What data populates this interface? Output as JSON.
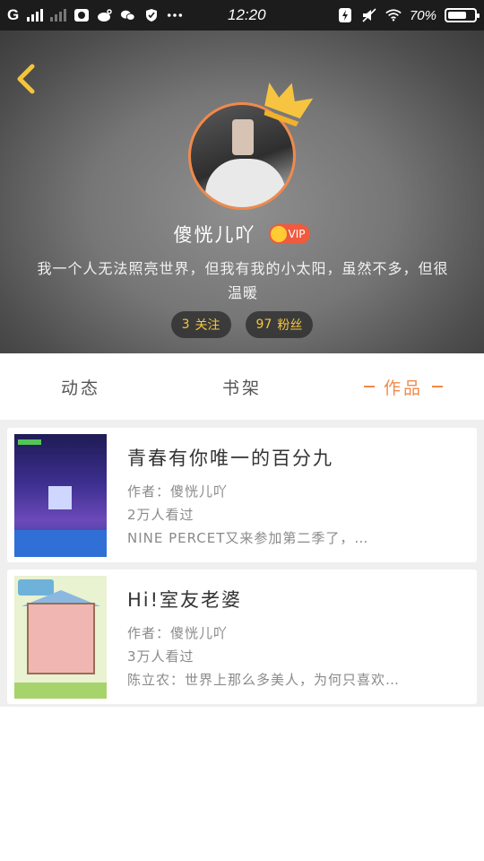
{
  "status_bar": {
    "carrier": "G",
    "time": "12:20",
    "battery": "70%",
    "battery_level": 0.7
  },
  "profile": {
    "username": "傻恍儿吖",
    "vip_label": "VIP",
    "bio": "我一个人无法照亮世界，但我有我的小太阳，虽然不多，但很温暖",
    "following_count": "3",
    "following_label": "关注",
    "followers_count": "97",
    "followers_label": "粉丝"
  },
  "tabs": [
    {
      "label": "动态"
    },
    {
      "label": "书架"
    },
    {
      "label": "作品"
    }
  ],
  "works": [
    {
      "title": "青春有你唯一的百分九",
      "author": "作者：傻恍儿吖",
      "views": "2万人看过",
      "excerpt": "NINE PERCET又来参加第二季了，…"
    },
    {
      "title": "Hi!室友老婆",
      "author": "作者：傻恍儿吖",
      "views": "3万人看过",
      "excerpt": "陈立农：世界上那么多美人，为何只喜欢…"
    }
  ],
  "colors": {
    "accent": "#f08a4b",
    "stat_text": "#f5c63a",
    "vip_badge": "#f05a3d"
  }
}
